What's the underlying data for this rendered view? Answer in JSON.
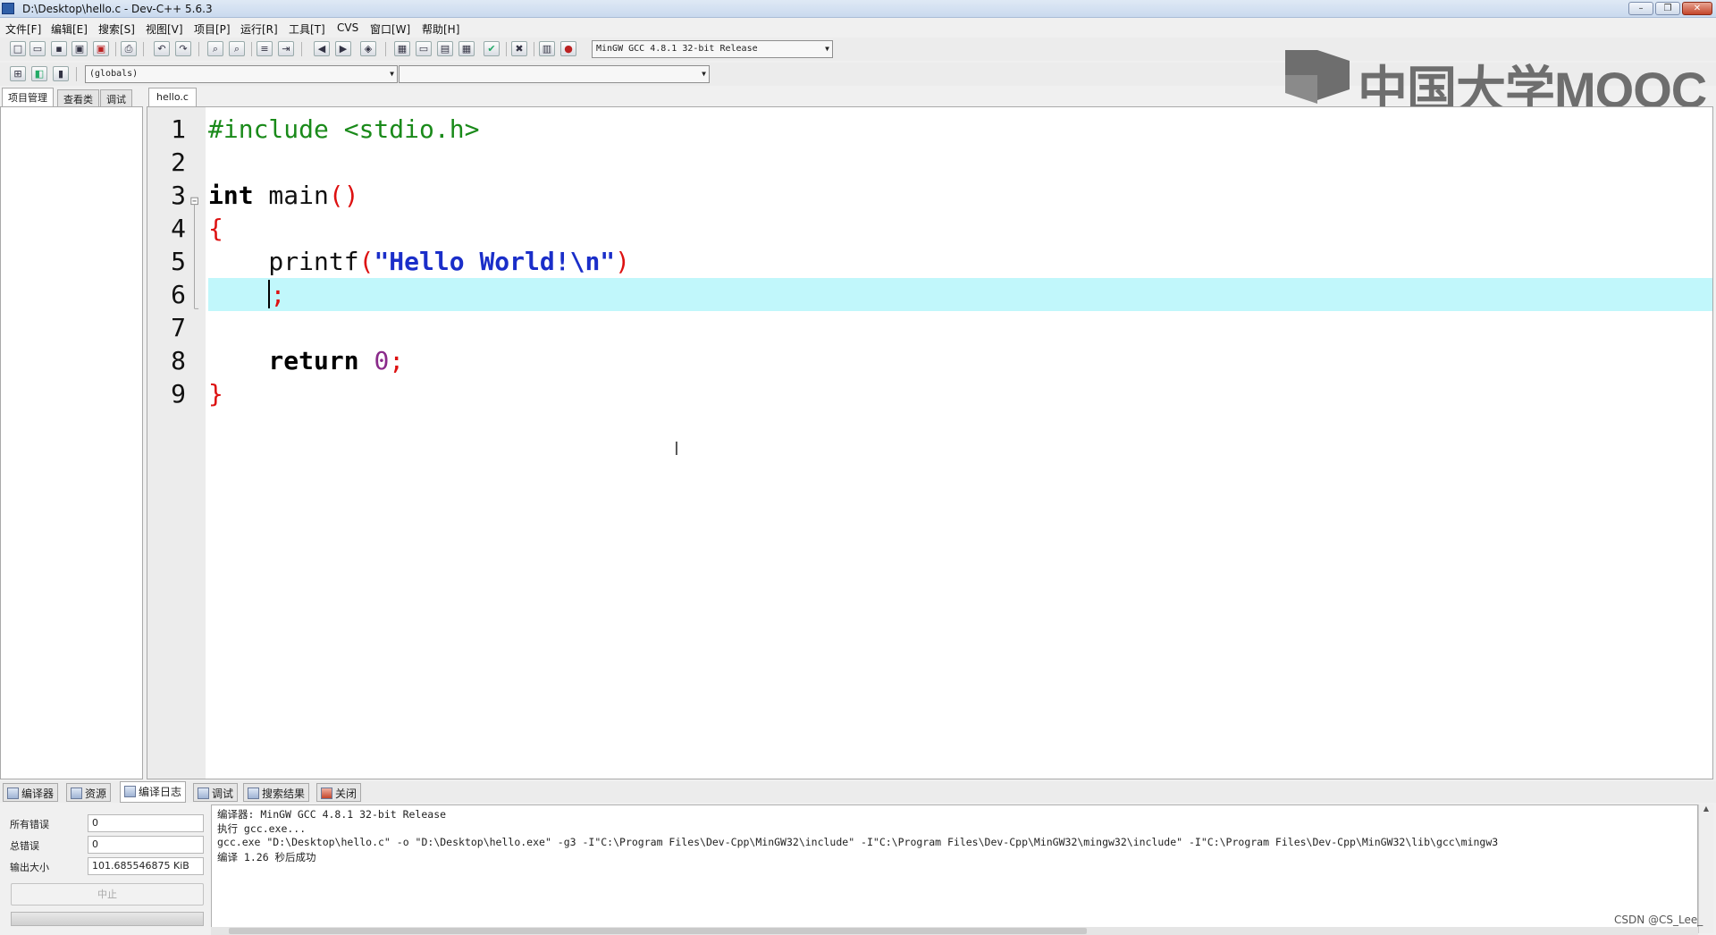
{
  "window": {
    "title": "D:\\Desktop\\hello.c - Dev-C++ 5.6.3",
    "min_label": "–",
    "max_label": "❐",
    "close_label": "✕"
  },
  "menu": [
    "文件[F]",
    "编辑[E]",
    "搜索[S]",
    "视图[V]",
    "项目[P]",
    "运行[R]",
    "工具[T]",
    "CVS",
    "窗口[W]",
    "帮助[H]"
  ],
  "toolbar": {
    "compiler_select": "MinGW GCC 4.8.1 32-bit Release",
    "scope_select": "(globals)",
    "function_select": ""
  },
  "watermark": {
    "text": "中国大学MOOC"
  },
  "left_panel": {
    "tabs": [
      "项目管理",
      "查看类",
      "调试"
    ]
  },
  "editor": {
    "file_tab": "hello.c",
    "line_numbers": [
      "1",
      "2",
      "3",
      "4",
      "5",
      "6",
      "7",
      "8",
      "9"
    ],
    "lines": [
      {
        "tokens": [
          {
            "t": "#include <stdio.h>",
            "c": "pp"
          }
        ]
      },
      {
        "tokens": []
      },
      {
        "tokens": [
          {
            "t": "int",
            "c": "kw"
          },
          {
            "t": " main",
            "c": "plain"
          },
          {
            "t": "()",
            "c": "paren"
          }
        ]
      },
      {
        "tokens": [
          {
            "t": "{",
            "c": "paren"
          }
        ]
      },
      {
        "tokens": [
          {
            "t": "    printf",
            "c": "plain"
          },
          {
            "t": "(",
            "c": "paren"
          },
          {
            "t": "\"Hello World!\\n\"",
            "c": "str"
          },
          {
            "t": ")",
            "c": "paren"
          }
        ]
      },
      {
        "tokens": [
          {
            "t": "    ",
            "c": "plain"
          },
          {
            "t": "",
            "c": "caret"
          },
          {
            "t": ";",
            "c": "paren"
          }
        ]
      },
      {
        "tokens": []
      },
      {
        "tokens": [
          {
            "t": "    return",
            "c": "kw"
          },
          {
            "t": " ",
            "c": "plain"
          },
          {
            "t": "0",
            "c": "num"
          },
          {
            "t": ";",
            "c": "paren"
          }
        ]
      },
      {
        "tokens": [
          {
            "t": "}",
            "c": "paren"
          }
        ]
      }
    ],
    "current_line": 6
  },
  "bottom_tabs": [
    "编译器",
    "资源",
    "编译日志",
    "调试",
    "搜索结果",
    "关闭"
  ],
  "active_bottom_tab": "编译日志",
  "stats": {
    "errors_label": "所有错误",
    "errors_value": "0",
    "total_label": "总错误",
    "total_value": "0",
    "size_label": "输出大小",
    "size_value": "101.685546875 KiB",
    "stop_label": "中止"
  },
  "log": [
    "编译器: MinGW GCC 4.8.1 32-bit Release",
    "执行 gcc.exe...",
    "gcc.exe \"D:\\Desktop\\hello.c\" -o \"D:\\Desktop\\hello.exe\" -g3 -I\"C:\\Program Files\\Dev-Cpp\\MinGW32\\include\" -I\"C:\\Program Files\\Dev-Cpp\\MinGW32\\mingw32\\include\" -I\"C:\\Program Files\\Dev-Cpp\\MinGW32\\lib\\gcc\\mingw3",
    "编译 1.26 秒后成功"
  ],
  "footer_credit": "CSDN @CS_Lee_"
}
